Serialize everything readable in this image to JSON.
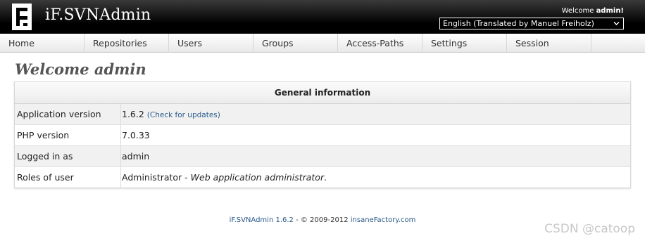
{
  "header": {
    "app_title": "iF.SVNAdmin",
    "welcome_prefix": "Welcome",
    "welcome_user": "admin!",
    "language_selected": "English (Translated by Manuel Freiholz)"
  },
  "nav": {
    "items": [
      "Home",
      "Repositories",
      "Users",
      "Groups",
      "Access-Paths",
      "Settings",
      "Session"
    ]
  },
  "main": {
    "title": "Welcome admin",
    "panel_title": "General information",
    "rows": [
      {
        "label": "Application version",
        "value": "1.6.2",
        "link": "(Check for updates)"
      },
      {
        "label": "PHP version",
        "value": "7.0.33"
      },
      {
        "label": "Logged in as",
        "value": "admin"
      },
      {
        "label": "Roles of user",
        "value": "Administrator - ",
        "value_italic": "Web application administrator",
        "value_suffix": "."
      }
    ]
  },
  "footer": {
    "product": "iF.SVNAdmin 1.6.2",
    "sep": " - © 2009-2012 ",
    "company": "insaneFactory.com"
  },
  "watermark": "CSDN @catoop",
  "colors": {
    "header_bg": "#000000",
    "link": "#2a5a8a",
    "title": "#555555"
  }
}
